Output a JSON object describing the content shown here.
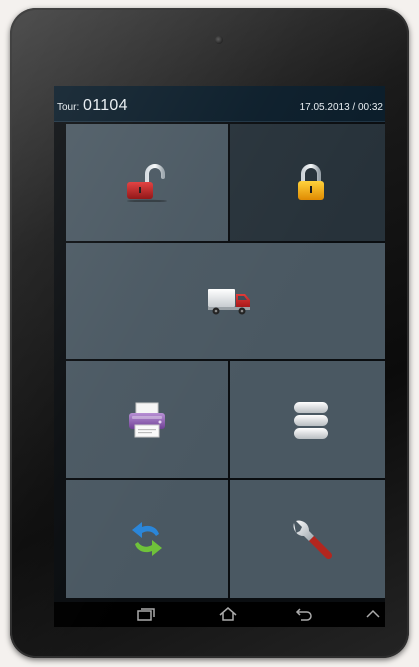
{
  "status": {
    "tour_label": "Tour:",
    "tour_value": "01104",
    "datetime": "17.05.2013 / 00:32"
  },
  "tiles": [
    {
      "name": "unlock",
      "icon": "unlock-icon"
    },
    {
      "name": "lock",
      "icon": "lock-icon"
    },
    {
      "name": "truck",
      "icon": "truck-icon"
    },
    {
      "name": "print",
      "icon": "printer-icon"
    },
    {
      "name": "list",
      "icon": "stack-icon"
    },
    {
      "name": "sync",
      "icon": "sync-arrows-icon"
    },
    {
      "name": "settings",
      "icon": "wrench-icon"
    }
  ],
  "navbar": {
    "buttons": [
      "recent-apps-icon",
      "home-icon",
      "back-icon",
      "up-chevron-icon"
    ]
  },
  "colors": {
    "tile": "#4a5862",
    "tile_selected": "#27323a",
    "statusbar": "#0b1d2a"
  }
}
